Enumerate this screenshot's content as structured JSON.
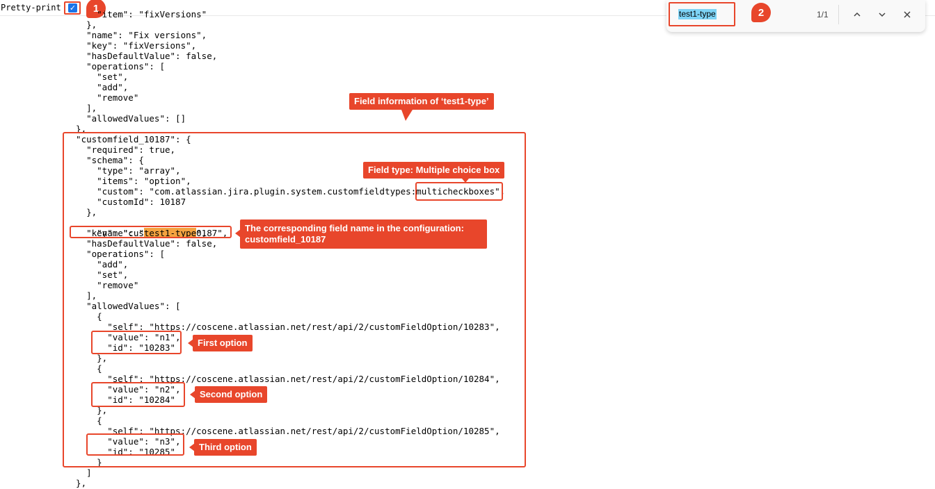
{
  "toolbar": {
    "pretty_print_label": "Pretty-print",
    "pretty_print_checked": true,
    "checkmark": "✓"
  },
  "find_bar": {
    "query": "test1-type",
    "match_count": "1/1",
    "prev_icon": "chevron-up-icon",
    "next_icon": "chevron-down-icon",
    "close_icon": "close-icon"
  },
  "badges": {
    "one": "1",
    "two": "2"
  },
  "code": {
    "lines": [
      "      \"item\": \"fixVersions\"",
      "    },",
      "    \"name\": \"Fix versions\",",
      "    \"key\": \"fixVersions\",",
      "    \"hasDefaultValue\": false,",
      "    \"operations\": [",
      "      \"set\",",
      "      \"add\",",
      "      \"remove\"",
      "    ],",
      "    \"allowedValues\": []",
      "  },",
      "  \"customfield_10187\": {",
      "    \"required\": true,",
      "    \"schema\": {",
      "      \"type\": \"array\",",
      "      \"items\": \"option\",",
      "      \"custom\": \"com.atlassian.jira.plugin.system.customfieldtypes:multicheckboxes\",",
      "      \"customId\": 10187",
      "    },",
      "    \"name\": \"test1-type\",",
      "    \"key\": \"customfield_10187\",",
      "    \"hasDefaultValue\": false,",
      "    \"operations\": [",
      "      \"add\",",
      "      \"set\",",
      "      \"remove\"",
      "    ],",
      "    \"allowedValues\": [",
      "      {",
      "        \"self\": \"https://coscene.atlassian.net/rest/api/2/customFieldOption/10283\",",
      "        \"value\": \"n1\",",
      "        \"id\": \"10283\"",
      "      },",
      "      {",
      "        \"self\": \"https://coscene.atlassian.net/rest/api/2/customFieldOption/10284\",",
      "        \"value\": \"n2\",",
      "        \"id\": \"10284\"",
      "      },",
      "      {",
      "        \"self\": \"https://coscene.atlassian.net/rest/api/2/customFieldOption/10285\",",
      "        \"value\": \"n3\",",
      "        \"id\": \"10285\"",
      "      }",
      "    ]",
      "  },"
    ],
    "name_line_prefix": "    \"name\": \"",
    "name_line_match": "test1-type",
    "name_line_suffix": "\","
  },
  "callouts": {
    "field_info": "Field information of ‘test1-type’",
    "field_type": "Field type: Multiple choice box",
    "field_name": "The corresponding field name in the configuration: customfield_10187",
    "first_option": "First option",
    "second_option": "Second option",
    "third_option": "Third option"
  },
  "colors": {
    "annotation_red": "#e8462b",
    "search_highlight": "#7dd3f5",
    "match_highlight": "#f4a340",
    "checkbox_blue": "#1a73e8"
  }
}
